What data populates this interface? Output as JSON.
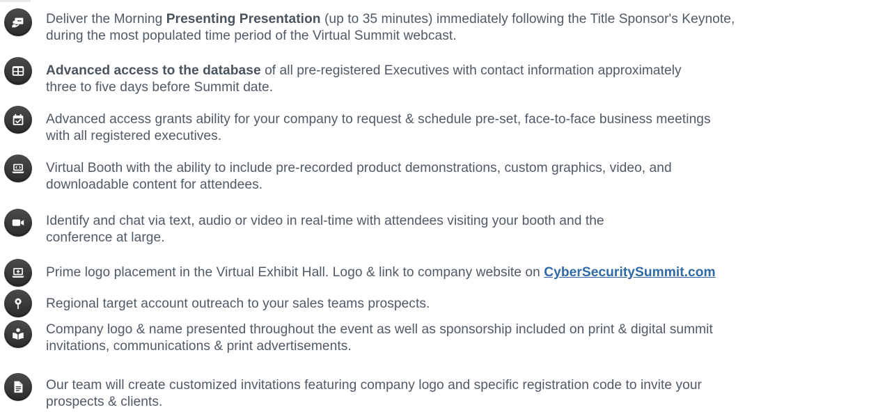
{
  "benefits": [
    {
      "icon": "presentation-icon",
      "lines": [
        [
          {
            "text": "Deliver the Morning "
          },
          {
            "text": "Presenting Presentation",
            "bold": true
          },
          {
            "text": " (up to 35 minutes) immediately following the Title Sponsor's Keynote,"
          }
        ],
        [
          {
            "text": "during the most populated time period of the Virtual Summit webcast."
          }
        ]
      ]
    },
    {
      "icon": "database-table-icon",
      "lines": [
        [
          {
            "text": "Advanced access to the database",
            "bold": true
          },
          {
            "text": " of all pre-registered Executives with contact information approximately"
          }
        ],
        [
          {
            "text": "three to five days before Summit date."
          }
        ]
      ]
    },
    {
      "icon": "calendar-check-icon",
      "lines": [
        [
          {
            "text": "Advanced access grants ability for your company to request & schedule pre-set, face-to-face business meetings"
          }
        ],
        [
          {
            "text": "with all registered executives."
          }
        ]
      ]
    },
    {
      "icon": "laptop-code-icon",
      "lines": [
        [
          {
            "text": "Virtual Booth with the ability to include pre-recorded product demonstrations, custom graphics, video, and"
          }
        ],
        [
          {
            "text": "downloadable content for attendees."
          }
        ]
      ]
    },
    {
      "icon": "video-camera-icon",
      "lines": [
        [
          {
            "text": "Identify and chat via text, audio or video in real-time with attendees visiting your booth and the"
          }
        ],
        [
          {
            "text": "conference at large."
          }
        ]
      ]
    },
    {
      "icon": "laptop-plus-icon",
      "lines": [
        [
          {
            "text": "Prime logo placement in the Virtual Exhibit Hall. Logo & link to company website on "
          },
          {
            "text": "CyberSecuritySummit.com",
            "link": true
          }
        ]
      ]
    },
    {
      "icon": "map-pin-icon",
      "lines": [
        [
          {
            "text": "Regional target account outreach to your sales teams prospects."
          }
        ]
      ]
    },
    {
      "icon": "person-reading-icon",
      "lines": [
        [
          {
            "text": "Company logo & name presented throughout the event as well as sponsorship included on print & digital summit"
          }
        ],
        [
          {
            "text": "invitations, communications & print advertisements."
          }
        ]
      ]
    },
    {
      "icon": "document-icon",
      "lines": [
        [
          {
            "text": "Our team will create customized invitations featuring company logo and specific registration code to invite your"
          }
        ],
        [
          {
            "text": "prospects & clients."
          }
        ]
      ]
    }
  ]
}
